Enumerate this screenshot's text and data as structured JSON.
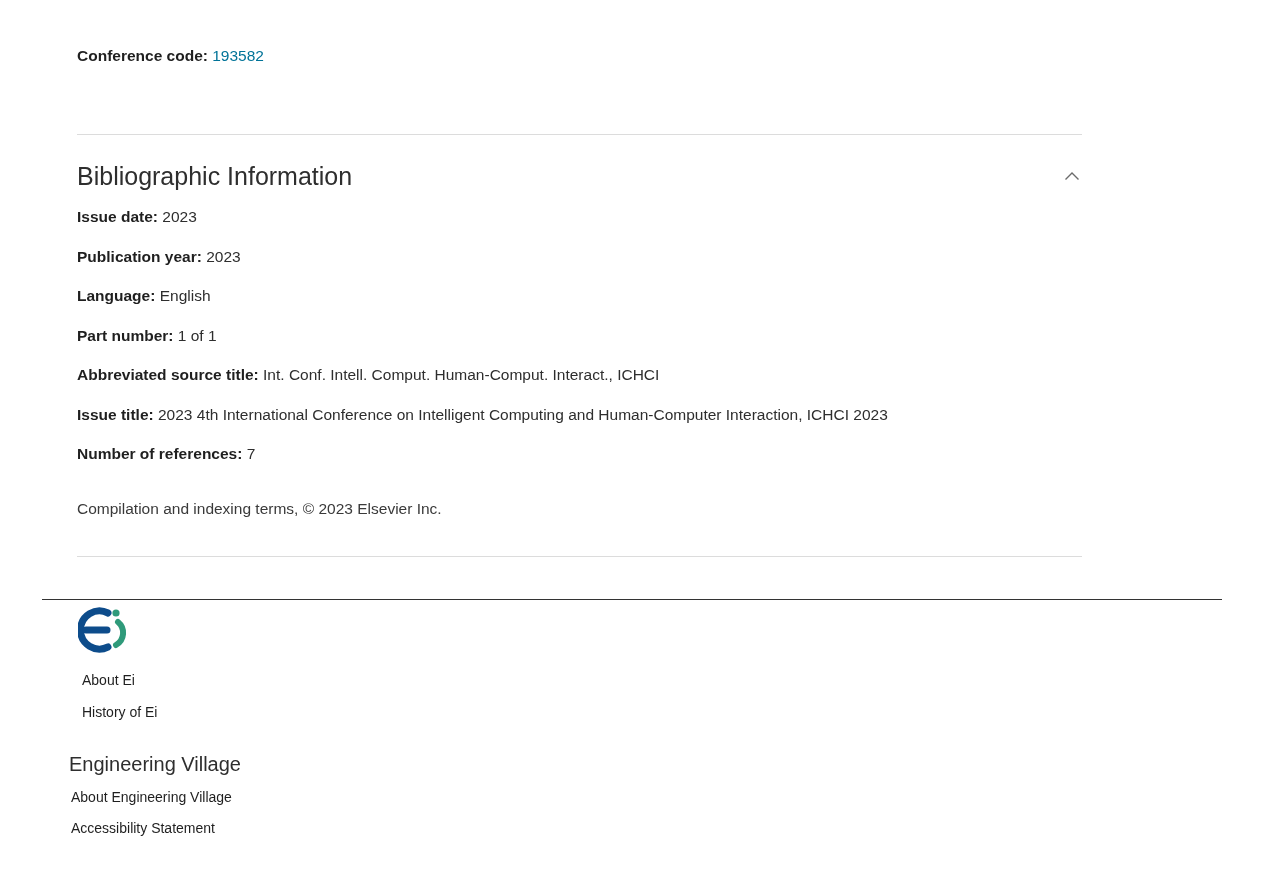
{
  "conference": {
    "label": "Conference code:",
    "value": "193582"
  },
  "section": {
    "title": "Bibliographic Information",
    "expanded": true,
    "fields": [
      {
        "label": "Issue date:",
        "value": "2023"
      },
      {
        "label": "Publication year:",
        "value": "2023"
      },
      {
        "label": "Language:",
        "value": "English"
      },
      {
        "label": "Part number:",
        "value": "1 of 1"
      },
      {
        "label": "Abbreviated source title:",
        "value": "Int. Conf. Intell. Comput. Human-Comput. Interact., ICHCI"
      },
      {
        "label": "Issue title:",
        "value": "2023 4th International Conference on Intelligent Computing and Human-Computer Interaction, ICHCI 2023"
      },
      {
        "label": "Number of references:",
        "value": "7"
      }
    ],
    "copyright": "Compilation and indexing terms, © 2023 Elsevier Inc."
  },
  "footer": {
    "ei_links": [
      "About Ei",
      "History of Ei"
    ],
    "heading": "Engineering Village",
    "village_links": [
      "About Engineering Village",
      "Accessibility Statement"
    ]
  }
}
